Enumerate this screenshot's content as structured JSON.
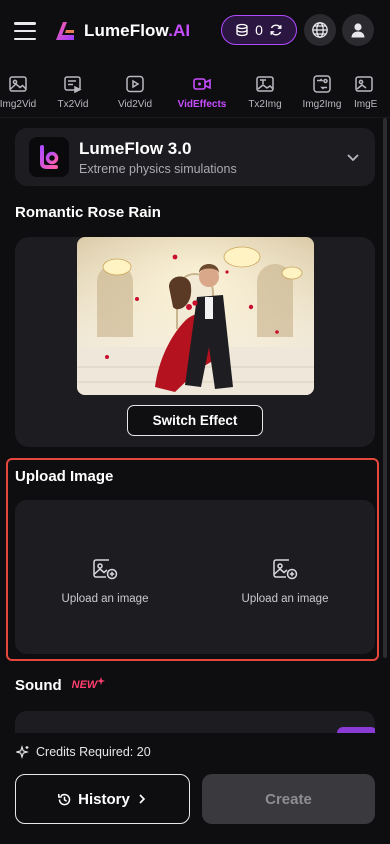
{
  "header": {
    "brand": "LumeFlow",
    "brand_suffix": ".AI",
    "credits": "0",
    "accent": "#c84dff"
  },
  "tabs": [
    {
      "label": "Img2Vid",
      "icon": "image-icon"
    },
    {
      "label": "Tx2Vid",
      "icon": "text-video-icon"
    },
    {
      "label": "Vid2Vid",
      "icon": "video-play-icon"
    },
    {
      "label": "VidEffects",
      "icon": "video-effects-icon",
      "active": true
    },
    {
      "label": "Tx2Img",
      "icon": "text-image-icon"
    },
    {
      "label": "Img2Img",
      "icon": "image-to-image-icon"
    },
    {
      "label": "ImgE",
      "icon": "image-edit-icon"
    }
  ],
  "model": {
    "name": "LumeFlow 3.0",
    "subtitle": "Extreme physics simulations"
  },
  "effect": {
    "title": "Romantic Rose Rain",
    "switch_label": "Switch Effect"
  },
  "upload": {
    "title": "Upload Image",
    "slot_label_1": "Upload an image",
    "slot_label_2": "Upload an image",
    "highlight_color": "#e5473c"
  },
  "sound": {
    "title": "Sound",
    "badge": "NEW"
  },
  "footer": {
    "credits_required": "Credits Required: 20",
    "history_label": "History",
    "create_label": "Create"
  }
}
